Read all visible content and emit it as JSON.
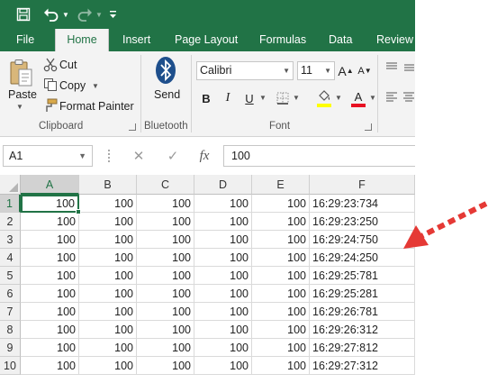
{
  "quick_access": {
    "save_icon": "save-icon",
    "undo_icon": "undo-icon",
    "redo_icon": "redo-icon",
    "customize_icon": "customize-qat-icon"
  },
  "tabs": [
    {
      "label": "File"
    },
    {
      "label": "Home"
    },
    {
      "label": "Insert"
    },
    {
      "label": "Page Layout"
    },
    {
      "label": "Formulas"
    },
    {
      "label": "Data"
    },
    {
      "label": "Review"
    }
  ],
  "active_tab": "Home",
  "ribbon": {
    "clipboard": {
      "paste_label": "Paste",
      "cut_label": "Cut",
      "copy_label": "Copy",
      "format_painter_label": "Format Painter",
      "group_label": "Clipboard"
    },
    "bluetooth": {
      "send_label": "Send",
      "group_label": "Bluetooth"
    },
    "font": {
      "font_name": "Calibri",
      "font_size": "11",
      "bold": "B",
      "italic": "I",
      "underline": "U",
      "grow_font": "A",
      "shrink_font": "A",
      "font_color": "A",
      "group_label": "Font",
      "highlight_color": "#ffff00",
      "font_color_bar": "#e81123"
    }
  },
  "formula_bar": {
    "name_box": "A1",
    "cancel": "✕",
    "enter": "✓",
    "fx": "fx",
    "value": "100"
  },
  "sheet": {
    "columns": [
      "A",
      "B",
      "C",
      "D",
      "E",
      "F"
    ],
    "rows": [
      {
        "num": "1",
        "cells": [
          "100",
          "100",
          "100",
          "100",
          "100",
          "16:29:23:734"
        ]
      },
      {
        "num": "2",
        "cells": [
          "100",
          "100",
          "100",
          "100",
          "100",
          "16:29:23:250"
        ]
      },
      {
        "num": "3",
        "cells": [
          "100",
          "100",
          "100",
          "100",
          "100",
          "16:29:24:750"
        ]
      },
      {
        "num": "4",
        "cells": [
          "100",
          "100",
          "100",
          "100",
          "100",
          "16:29:24:250"
        ]
      },
      {
        "num": "5",
        "cells": [
          "100",
          "100",
          "100",
          "100",
          "100",
          "16:29:25:781"
        ]
      },
      {
        "num": "6",
        "cells": [
          "100",
          "100",
          "100",
          "100",
          "100",
          "16:29:25:281"
        ]
      },
      {
        "num": "7",
        "cells": [
          "100",
          "100",
          "100",
          "100",
          "100",
          "16:29:26:781"
        ]
      },
      {
        "num": "8",
        "cells": [
          "100",
          "100",
          "100",
          "100",
          "100",
          "16:29:26:312"
        ]
      },
      {
        "num": "9",
        "cells": [
          "100",
          "100",
          "100",
          "100",
          "100",
          "16:29:27:812"
        ]
      },
      {
        "num": "10",
        "cells": [
          "100",
          "100",
          "100",
          "100",
          "100",
          "16:29:27:312"
        ]
      }
    ],
    "active_cell": "A1"
  },
  "colors": {
    "excel_green": "#217346",
    "arrow_red": "#e53935"
  }
}
